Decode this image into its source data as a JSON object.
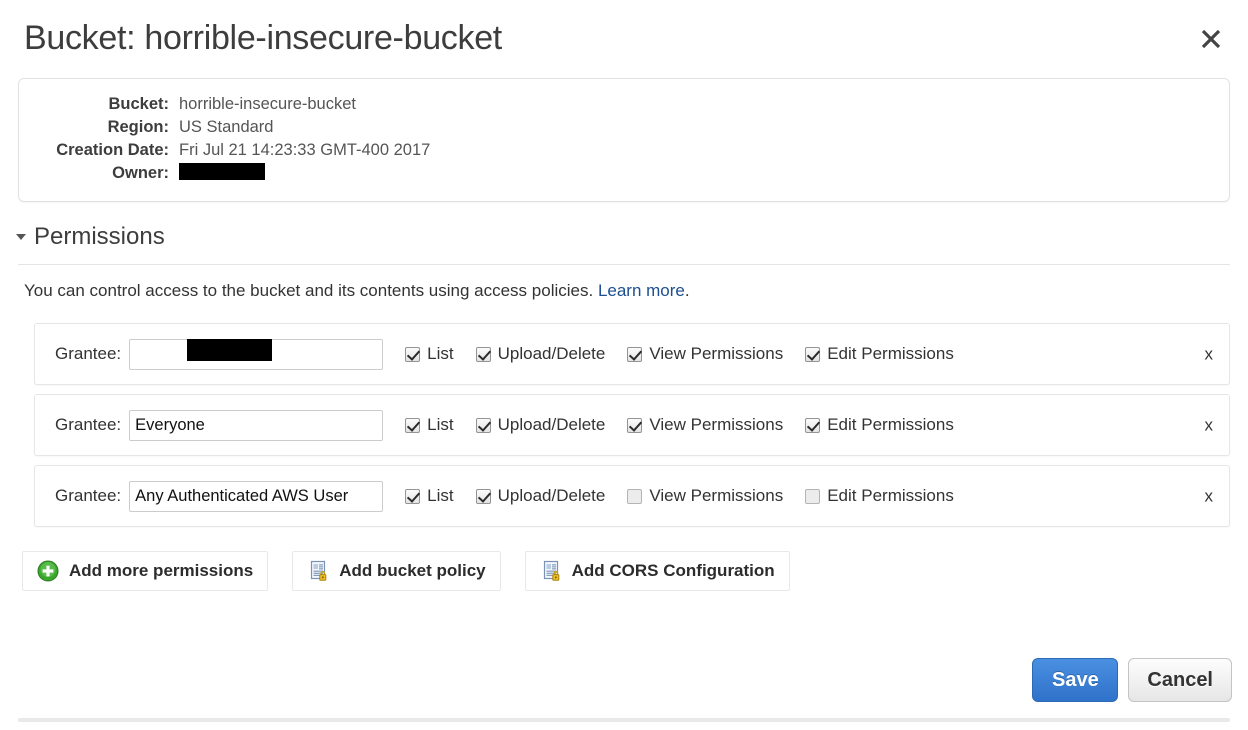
{
  "header": {
    "title": "Bucket: horrible-insecure-bucket",
    "close_icon": "close-icon"
  },
  "info": {
    "rows": [
      {
        "label": "Bucket:",
        "value": "horrible-insecure-bucket",
        "redacted": false
      },
      {
        "label": "Region:",
        "value": "US Standard",
        "redacted": false
      },
      {
        "label": "Creation Date:",
        "value": "Fri Jul 21 14:23:33 GMT-400 2017",
        "redacted": false
      },
      {
        "label": "Owner:",
        "value": "",
        "redacted": true
      }
    ]
  },
  "permissions": {
    "section_title": "Permissions",
    "twisty_icon": "triangle-down-icon",
    "intro_text": "You can control access to the bucket and its contents using access policies. ",
    "intro_link": "Learn more",
    "intro_tail": ".",
    "grantee_label": "Grantee:",
    "delete_label": "x",
    "permission_labels": [
      "List",
      "Upload/Delete",
      "View Permissions",
      "Edit Permissions"
    ],
    "grants": [
      {
        "grantee": "",
        "redacted": true,
        "list": true,
        "upload_delete": true,
        "view_permissions": true,
        "edit_permissions": true
      },
      {
        "grantee": "Everyone",
        "redacted": false,
        "list": true,
        "upload_delete": true,
        "view_permissions": true,
        "edit_permissions": true
      },
      {
        "grantee": "Any Authenticated AWS User",
        "redacted": false,
        "list": true,
        "upload_delete": true,
        "view_permissions": false,
        "edit_permissions": false
      }
    ]
  },
  "actions": [
    {
      "label": "Add more permissions",
      "icon": "green-plus-circle-icon"
    },
    {
      "label": "Add bucket policy",
      "icon": "document-lock-icon"
    },
    {
      "label": "Add CORS Configuration",
      "icon": "document-lock-icon"
    }
  ],
  "footer": {
    "save_label": "Save",
    "cancel_label": "Cancel"
  },
  "colors": {
    "link": "#1c4f8f",
    "save_button": "#3a7fd5",
    "redaction": "#000000",
    "plus_icon": "#3aa62b",
    "lock_icon": "#f2c020"
  }
}
